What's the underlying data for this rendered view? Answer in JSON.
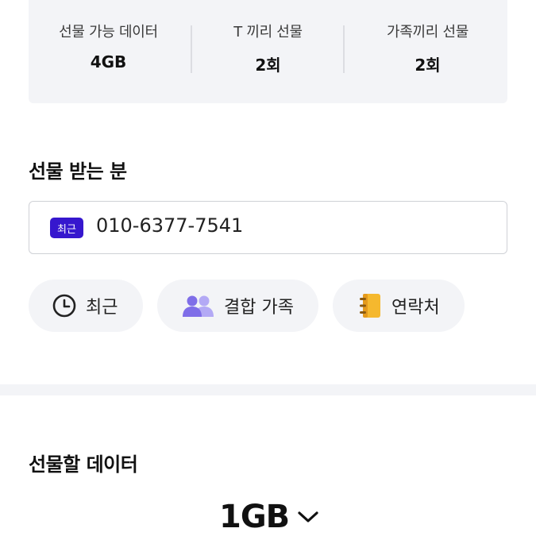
{
  "summary": {
    "stats": [
      {
        "label": "선물 가능 데이터",
        "value": "4GB"
      },
      {
        "label": "T 끼리 선물",
        "value": "2회"
      },
      {
        "label": "가족끼리 선물",
        "value": "2회"
      }
    ]
  },
  "recipient": {
    "title": "선물 받는 분",
    "tag": "최근",
    "phone": "010-6377-7541"
  },
  "chips": [
    {
      "label": "최근",
      "icon": "clock-icon"
    },
    {
      "label": "결합 가족",
      "icon": "people-icon"
    },
    {
      "label": "연락처",
      "icon": "contact-book-icon"
    }
  ],
  "gift_data": {
    "title": "선물할 데이터",
    "amount": "1GB"
  },
  "colors": {
    "accent": "#3617ce",
    "people_icon": "#8b7cf0",
    "contact_icon": "#f5b82e",
    "panel_bg": "#f3f4f7"
  }
}
